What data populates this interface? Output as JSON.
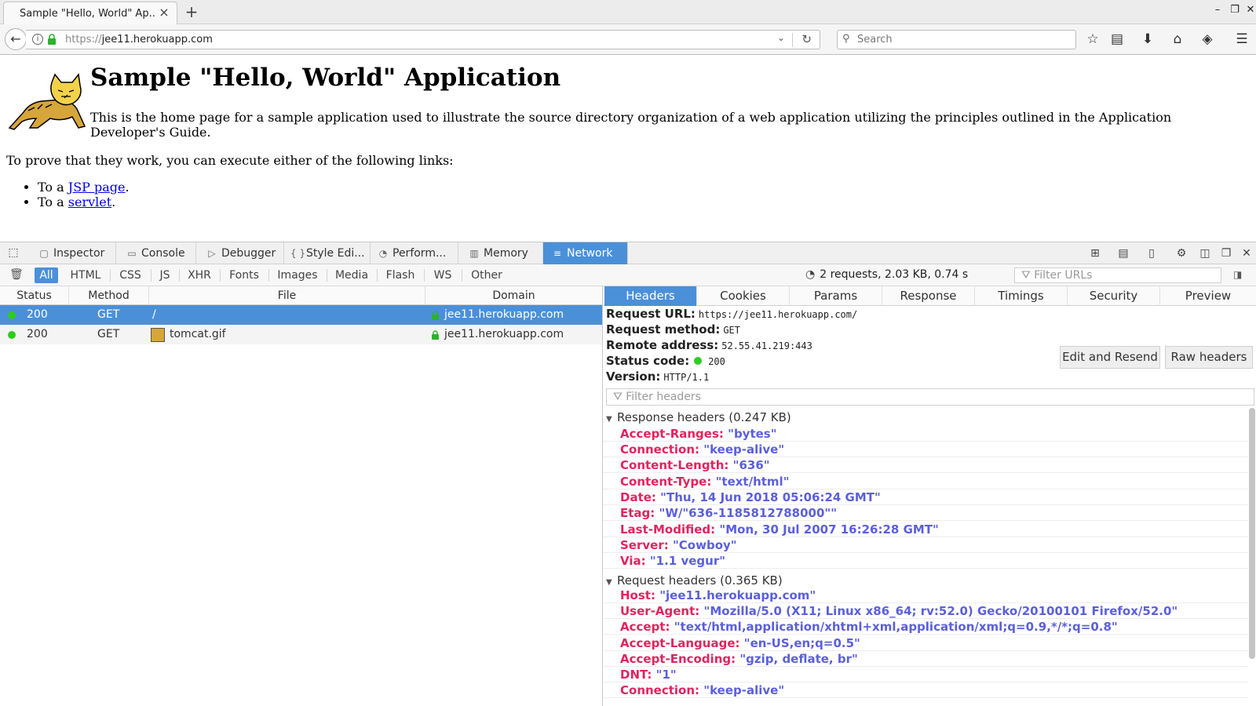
{
  "browser": {
    "tab_title": "Sample \"Hello, World\" Ap...",
    "url_scheme": "https://",
    "url_host": "jee11.herokuapp.com",
    "search_placeholder": "Search"
  },
  "page": {
    "heading": "Sample \"Hello, World\" Application",
    "intro": "This is the home page for a sample application used to illustrate the source directory organization of a web application utilizing the principles outlined in the Application Developer's Guide.",
    "prove": "To prove that they work, you can execute either of the following links:",
    "links": [
      {
        "prefix": "To a ",
        "text": "JSP page",
        "suffix": "."
      },
      {
        "prefix": "To a ",
        "text": "servlet",
        "suffix": "."
      }
    ]
  },
  "devtools": {
    "tabs": [
      "Inspector",
      "Console",
      "Debugger",
      "Style Edi...",
      "Perform...",
      "Memory",
      "Network"
    ],
    "filters": [
      "All",
      "HTML",
      "CSS",
      "JS",
      "XHR",
      "Fonts",
      "Images",
      "Media",
      "Flash",
      "WS",
      "Other"
    ],
    "summary": "2 requests, 2.03 KB, 0.74 s",
    "filter_urls_placeholder": "Filter URLs",
    "columns": [
      "Status",
      "Method",
      "File",
      "Domain"
    ],
    "requests": [
      {
        "status": "200",
        "method": "GET",
        "file": "/",
        "domain": "jee11.herokuapp.com"
      },
      {
        "status": "200",
        "method": "GET",
        "file": "tomcat.gif",
        "domain": "jee11.herokuapp.com"
      }
    ],
    "detail_tabs": [
      "Headers",
      "Cookies",
      "Params",
      "Response",
      "Timings",
      "Security",
      "Preview"
    ],
    "request_summary": {
      "url_label": "Request URL:",
      "url": "https://jee11.herokuapp.com/",
      "method_label": "Request method:",
      "method": "GET",
      "address_label": "Remote address:",
      "address": "52.55.41.219:443",
      "status_label": "Status code:",
      "status": "200",
      "version_label": "Version:",
      "version": "HTTP/1.1"
    },
    "edit_resend": "Edit and Resend",
    "raw_headers": "Raw headers",
    "filter_headers_placeholder": "Filter headers",
    "response_title": "Response headers (0.247 KB)",
    "response_headers": [
      {
        "name": "Accept-Ranges",
        "value": "\"bytes\""
      },
      {
        "name": "Connection",
        "value": "\"keep-alive\""
      },
      {
        "name": "Content-Length",
        "value": "\"636\""
      },
      {
        "name": "Content-Type",
        "value": "\"text/html\""
      },
      {
        "name": "Date",
        "value": "\"Thu, 14 Jun 2018 05:06:24 GMT\""
      },
      {
        "name": "Etag",
        "value": "\"W/\"636-1185812788000\"\""
      },
      {
        "name": "Last-Modified",
        "value": "\"Mon, 30 Jul 2007 16:26:28 GMT\""
      },
      {
        "name": "Server",
        "value": "\"Cowboy\""
      },
      {
        "name": "Via",
        "value": "\"1.1 vegur\""
      }
    ],
    "request_title": "Request headers (0.365 KB)",
    "request_headers": [
      {
        "name": "Host",
        "value": "\"jee11.herokuapp.com\""
      },
      {
        "name": "User-Agent",
        "value": "\"Mozilla/5.0 (X11; Linux x86_64; rv:52.0) Gecko/20100101 Firefox/52.0\""
      },
      {
        "name": "Accept",
        "value": "\"text/html,application/xhtml+xml,application/xml;q=0.9,*/*;q=0.8\""
      },
      {
        "name": "Accept-Language",
        "value": "\"en-US,en;q=0.5\""
      },
      {
        "name": "Accept-Encoding",
        "value": "\"gzip, deflate, br\""
      },
      {
        "name": "DNT",
        "value": "\"1\""
      },
      {
        "name": "Connection",
        "value": "\"keep-alive\""
      }
    ]
  },
  "colors": {
    "accent": "#4a90d9",
    "header_name": "#e0245e",
    "header_value": "#5b5fdd",
    "status_ok": "#2ecc1f"
  }
}
